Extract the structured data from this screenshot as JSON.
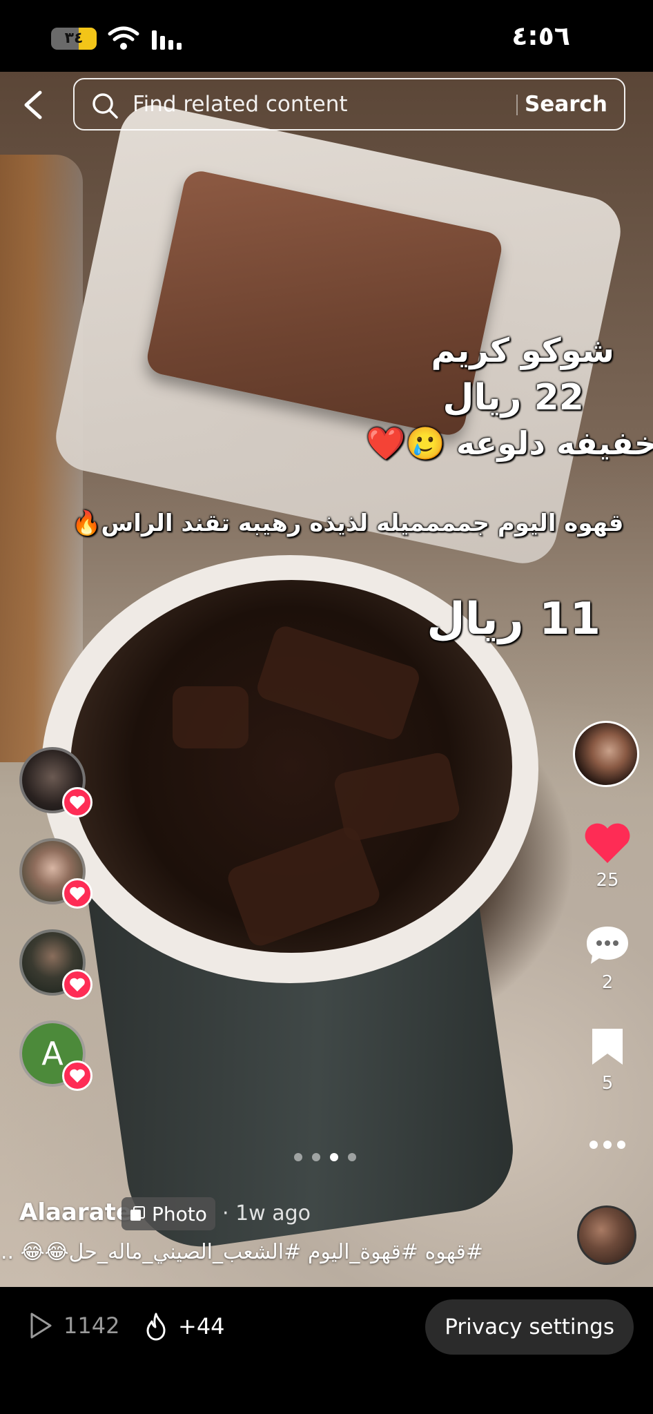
{
  "status": {
    "battery": "٣٤",
    "time": "٤:٥٦"
  },
  "search": {
    "placeholder": "Find related content",
    "button": "Search"
  },
  "overlay": {
    "line1": "شوكو كريم",
    "line2": "22 ريال",
    "line3": "خفيفه دلوعه 🥲❤️",
    "line4": "قهوه اليوم جمممميله لذيذه رهيبه تقند الراس🔥",
    "line5": "11 ريال"
  },
  "likers": {
    "initial": "A"
  },
  "actions": {
    "likes": "25",
    "comments": "2",
    "saves": "5"
  },
  "post": {
    "author": "Alaarate",
    "type": "Photo",
    "time": "· 1w ago",
    "caption": "#قهوه #قهوة_اليوم #الشعب_الصيني_ماله_حل😂😂 ..."
  },
  "bottom": {
    "views": "1142",
    "boost": "+44",
    "privacy": "Privacy settings"
  },
  "colors": {
    "accent_heart": "#fe2c55",
    "battery_fill": "#f3c518",
    "avatar_green": "#4c8a3a"
  }
}
